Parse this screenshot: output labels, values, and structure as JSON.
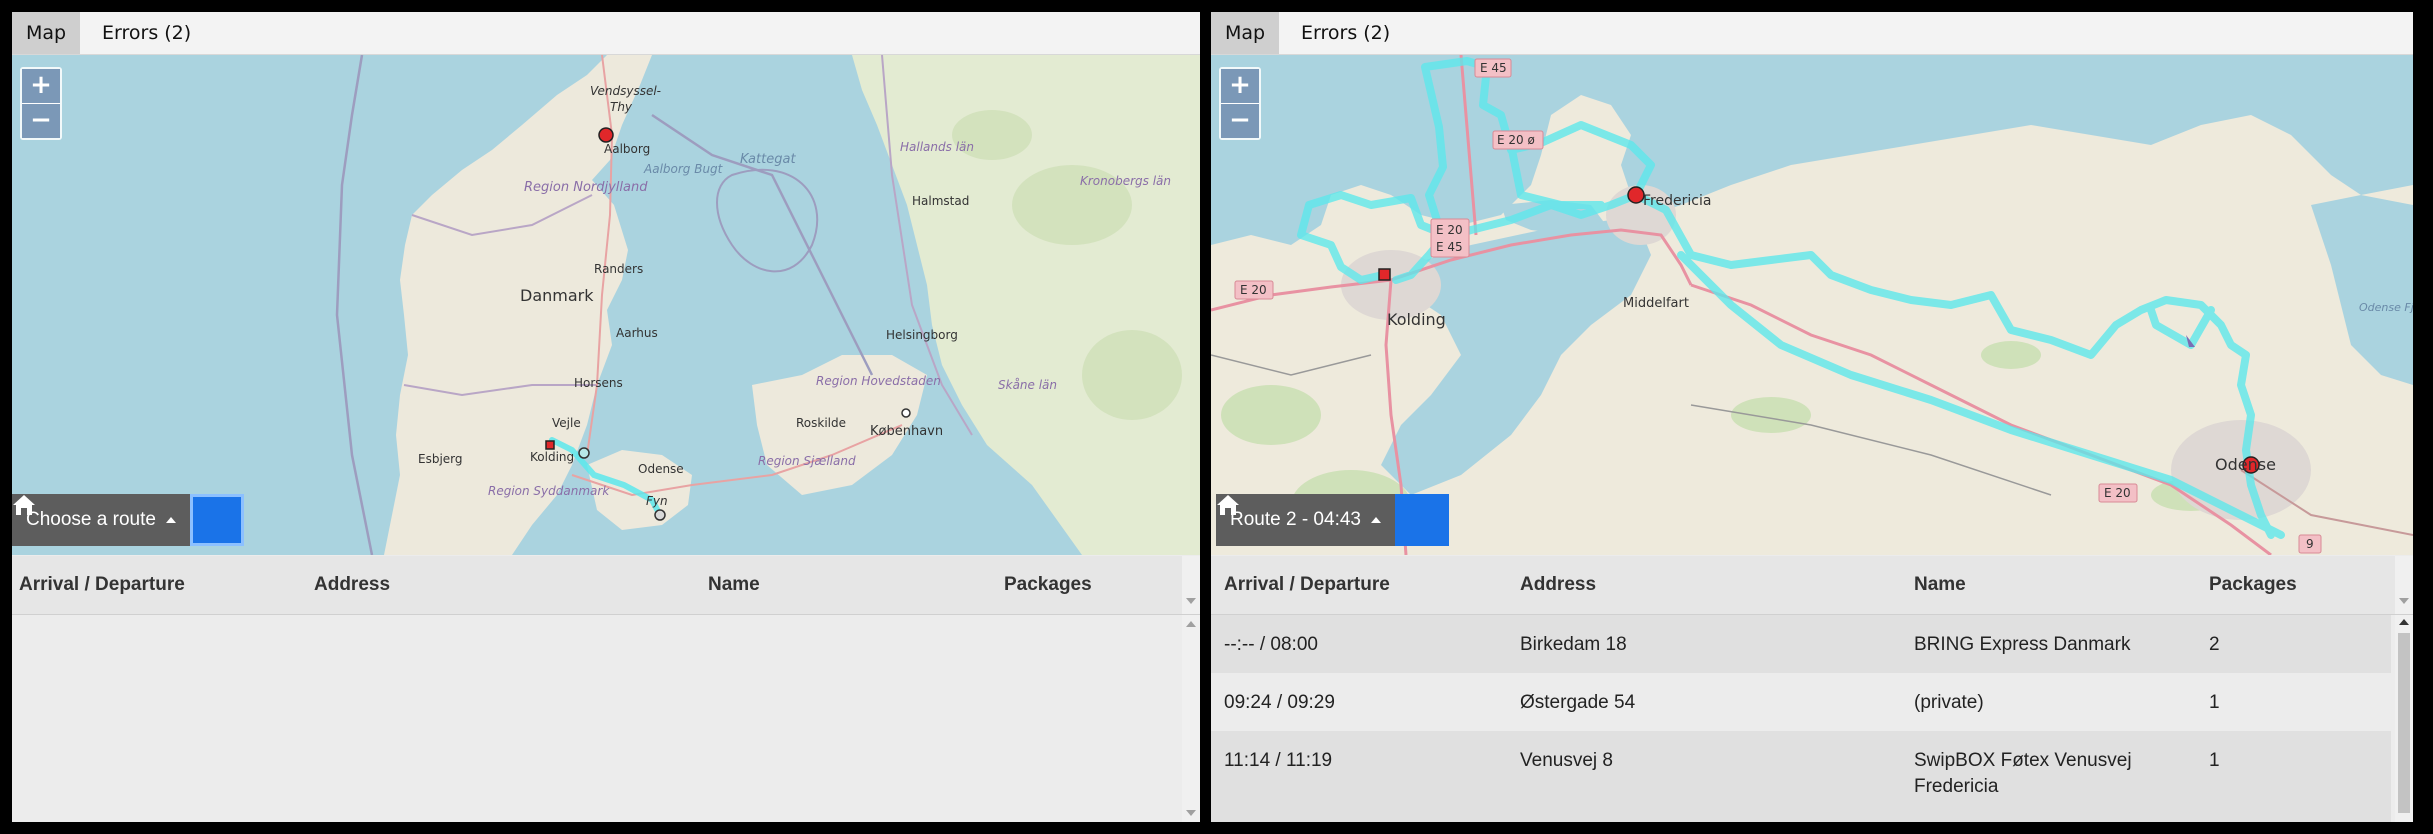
{
  "left_panel": {
    "tabs": [
      {
        "label": "Map"
      },
      {
        "label": "Errors (2)"
      }
    ],
    "map": {
      "zoom_in": "+",
      "zoom_out": "−",
      "labels": {
        "vendsyssel": "Vendsyssel-",
        "thy": "Thy",
        "aalborg": "Aalborg",
        "aalborg_bugt": "Aalborg Bugt",
        "nordjylland": "Region Nordjylland",
        "kattegat": "Kattegat",
        "hallands": "Hallands län",
        "halmstad": "Halmstad",
        "kronobergs": "Kronobergs län",
        "danmark": "Danmark",
        "randers": "Randers",
        "aarhus": "Aarhus",
        "horsens": "Horsens",
        "helsingborg": "Helsingborg",
        "hovedstaden": "Region Hovedstaden",
        "skane": "Skåne län",
        "vejle": "Vejle",
        "roskilde": "Roskilde",
        "kobenhavn": "København",
        "esbjerg": "Esbjerg",
        "kolding": "Kolding",
        "odense": "Odense",
        "sjaelland": "Region Sjælland",
        "syddanmark": "Region Syddanmark",
        "fyn": "Fyn"
      }
    },
    "route_select_label": "Choose a route",
    "table": {
      "headers": [
        "Arrival / Departure",
        "Address",
        "Name",
        "Packages"
      ],
      "rows": []
    }
  },
  "right_panel": {
    "tabs": [
      {
        "label": "Map"
      },
      {
        "label": "Errors (2)"
      }
    ],
    "map": {
      "zoom_in": "+",
      "zoom_out": "−",
      "labels": {
        "e45": "E 45",
        "e20o": "E 20 ø",
        "fredericia": "Fredericia",
        "e20": "E 20",
        "e45b": "E 45",
        "e20_left": "E 20",
        "kolding": "Kolding",
        "middelfart": "Middelfart",
        "odense": "Odense",
        "e20_bottom": "E 20",
        "route9": "9",
        "odense_fjord": "Odense Fjord"
      }
    },
    "route_select_label": "Route 2 - 04:43",
    "table": {
      "headers": [
        "Arrival / Departure",
        "Address",
        "Name",
        "Packages"
      ],
      "rows": [
        {
          "time": "--:-- / 08:00",
          "address": "Birkedam 18",
          "name": "BRING Express Danmark",
          "name2": "",
          "packages": "2"
        },
        {
          "time": "09:24 / 09:29",
          "address": "Østergade 54",
          "name": "(private)",
          "name2": "",
          "packages": "1"
        },
        {
          "time": "11:14 / 11:19",
          "address": "Venusvej 8",
          "name": "SwipBOX Føtex Venusvej",
          "name2": "Fredericia",
          "packages": "1"
        }
      ]
    }
  },
  "colors": {
    "water": "#aad3df",
    "land": "#eeeadc",
    "route": "#5ce8ec",
    "accent": "#1a73e8",
    "stop": "#e0272a"
  }
}
